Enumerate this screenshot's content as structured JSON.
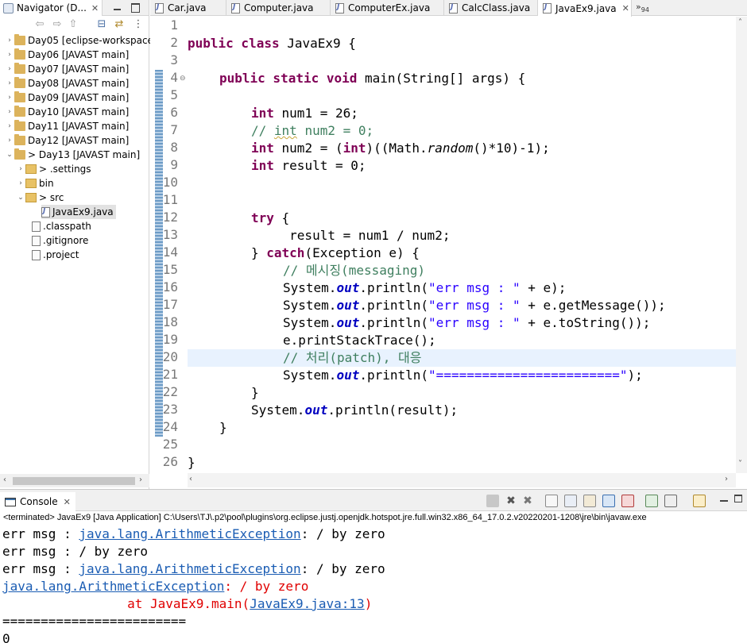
{
  "navigator": {
    "tab_label": "Navigator (D...",
    "items": [
      {
        "label": "Day05 [eclipse-workspace",
        "type": "project",
        "expanded": false
      },
      {
        "label": "Day06 [JAVAST main]",
        "type": "project",
        "expanded": false
      },
      {
        "label": "Day07 [JAVAST main]",
        "type": "project",
        "expanded": false
      },
      {
        "label": "Day08 [JAVAST main]",
        "type": "project",
        "expanded": false
      },
      {
        "label": "Day09 [JAVAST main]",
        "type": "project",
        "expanded": false
      },
      {
        "label": "Day10 [JAVAST main]",
        "type": "project",
        "expanded": false
      },
      {
        "label": "Day11 [JAVAST main]",
        "type": "project",
        "expanded": false
      },
      {
        "label": "Day12 [JAVAST main]",
        "type": "project",
        "expanded": false
      },
      {
        "label": "> Day13 [JAVAST main]",
        "type": "project",
        "expanded": true
      },
      {
        "label": "> .settings",
        "type": "folder",
        "expanded": false
      },
      {
        "label": "bin",
        "type": "folder",
        "expanded": false
      },
      {
        "label": "> src",
        "type": "folder",
        "expanded": true
      },
      {
        "label": "JavaEx9.java",
        "type": "java",
        "selected": true
      },
      {
        "label": ".classpath",
        "type": "file"
      },
      {
        "label": ".gitignore",
        "type": "file"
      },
      {
        "label": ".project",
        "type": "file"
      }
    ]
  },
  "editor": {
    "tabs": [
      {
        "label": "Car.java",
        "active": false
      },
      {
        "label": "Computer.java",
        "active": false
      },
      {
        "label": "ComputerEx.java",
        "active": false
      },
      {
        "label": "CalcClass.java",
        "active": false
      },
      {
        "label": "JavaEx9.java",
        "active": true
      }
    ],
    "more_tabs": "»",
    "more_tabs_count": "94",
    "highlighted_line": 20,
    "line_numbers": [
      "1",
      "2",
      "3",
      "4",
      "5",
      "6",
      "7",
      "8",
      "9",
      "10",
      "11",
      "12",
      "13",
      "14",
      "15",
      "16",
      "17",
      "18",
      "19",
      "20",
      "21",
      "22",
      "23",
      "24",
      "25",
      "26"
    ],
    "code": {
      "l2": [
        "public class",
        " JavaEx9 {"
      ],
      "l4": [
        "public static void",
        " main(String[] args) {"
      ],
      "l6": [
        "int",
        " num1 = 26;"
      ],
      "l7": [
        "// ",
        "int",
        " num2 = 0;"
      ],
      "l8": [
        "int",
        " num2 = (",
        "int",
        ")((Math.",
        "random",
        "()*10)-1);"
      ],
      "l9": [
        "int",
        " result = 0;"
      ],
      "l12": [
        "try",
        " {"
      ],
      "l13": "     result = num1 / num2;",
      "l14": [
        "} ",
        "catch",
        "(Exception e) {"
      ],
      "l15": "// 메시징(messaging)",
      "l16": [
        "System.",
        "out",
        ".println(",
        "\"err msg : \"",
        " + e);"
      ],
      "l17": [
        "System.",
        "out",
        ".println(",
        "\"err msg : \"",
        " + e.getMessage());"
      ],
      "l18": [
        "System.",
        "out",
        ".println(",
        "\"err msg : \"",
        " + e.toString());"
      ],
      "l19": "e.printStackTrace();",
      "l20": "// 처리(patch), 대응",
      "l21": [
        "System.",
        "out",
        ".println(",
        "\"========================\"",
        ");"
      ],
      "l22": "}",
      "l23": [
        "System.",
        "out",
        ".println(result);"
      ],
      "l24": "}",
      "l26": "}"
    }
  },
  "console": {
    "tab_label": "Console",
    "status": "<terminated> JavaEx9 [Java Application] C:\\Users\\TJ\\.p2\\pool\\plugins\\org.eclipse.justj.openjdk.hotspot.jre.full.win32.x86_64_17.0.2.v20220201-1208\\jre\\bin\\javaw.exe",
    "lines": {
      "o1": [
        "err msg : ",
        "java.lang.ArithmeticException",
        ": / by zero"
      ],
      "o2": "err msg : / by zero",
      "o3": [
        "err msg : ",
        "java.lang.ArithmeticException",
        ": / by zero"
      ],
      "o4": [
        "java.lang.ArithmeticException",
        ": / by zero"
      ],
      "o5": [
        "\tat JavaEx9.main(",
        "JavaEx9.java:13",
        ")"
      ],
      "o6": "========================",
      "o7": "0"
    }
  }
}
